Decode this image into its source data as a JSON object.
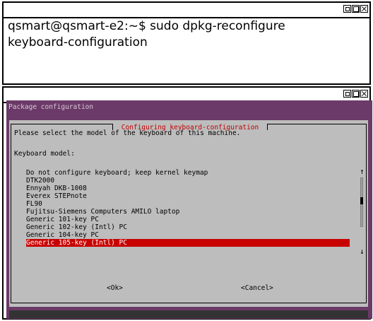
{
  "top_terminal": {
    "line1": "qsmart@qsmart-e2:~$ sudo dpkg-reconfigure",
    "line2": "keyboard-configuration"
  },
  "bottom_terminal": {
    "title": "Package configuration",
    "dialog": {
      "title": "Configuring keyboard-configuration",
      "prompt": "Please select the model of the keyboard of this machine.",
      "field_label": "Keyboard model:",
      "options": [
        "Do not configure keyboard; keep kernel keymap",
        "DTK2000",
        "Ennyah DKB-1008",
        "Everex STEPnote",
        "FL90",
        "Fujitsu-Siemens Computers AMILO laptop",
        "Generic 101-key PC",
        "Generic 102-key (Intl) PC",
        "Generic 104-key PC",
        "Generic 105-key (Intl) PC"
      ],
      "selected_index": 9,
      "ok_label": "<Ok>",
      "cancel_label": "<Cancel>",
      "scroll_up": "↑",
      "scroll_down": "↓"
    }
  },
  "colors": {
    "terminal_bg": "#6b3a68",
    "dialog_bg": "#bdbdbd",
    "selection": "#c80000",
    "dialog_title": "#c00000"
  }
}
